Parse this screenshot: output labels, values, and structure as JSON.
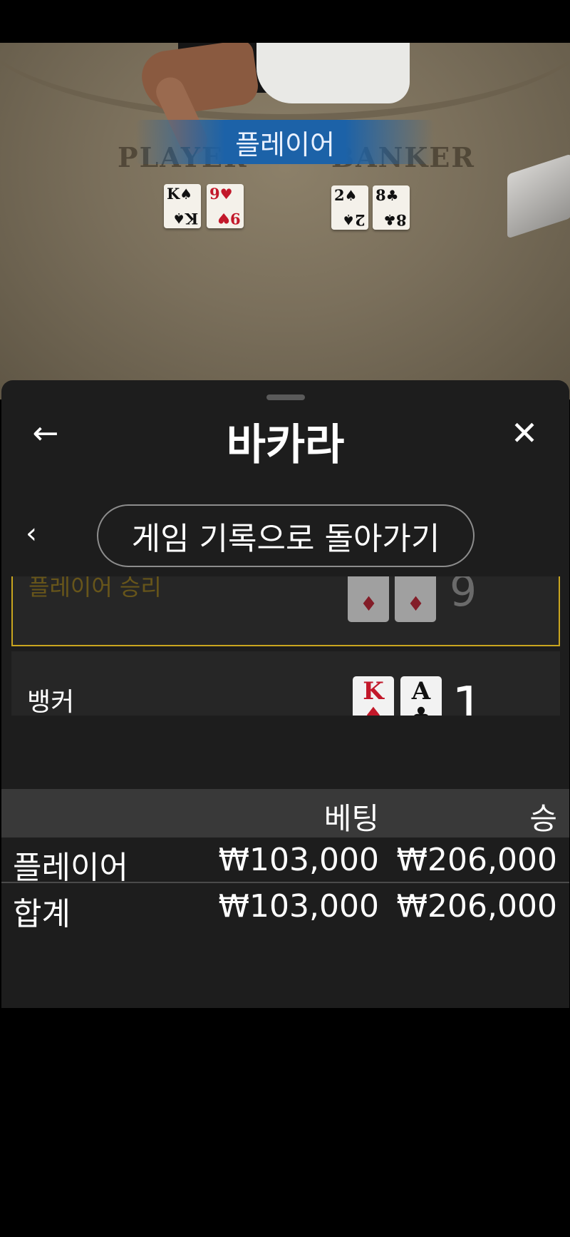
{
  "video": {
    "winner_banner": "플레이어",
    "zone_player": "PLAYER",
    "zone_banker": "BANKER",
    "player_cards": [
      {
        "rank": "K",
        "suit": "♠",
        "color": "black"
      },
      {
        "rank": "9",
        "suit": "♥",
        "color": "red"
      }
    ],
    "banker_cards": [
      {
        "rank": "2",
        "suit": "♠",
        "color": "black"
      },
      {
        "rank": "8",
        "suit": "♣",
        "color": "black"
      }
    ]
  },
  "header": {
    "title": "바카라",
    "back_icon": "←",
    "close_icon": "✕"
  },
  "nav": {
    "prev_icon": "‹",
    "history_button": "게임 기록으로 돌아가기"
  },
  "rounds": {
    "player_row": {
      "label": "플레이어 승리",
      "total": "9",
      "cards": [
        {
          "suit": "♦"
        },
        {
          "suit": "♦"
        }
      ]
    },
    "banker_row": {
      "label": "뱅커",
      "total": "1",
      "cards": [
        {
          "rank": "K",
          "suit": "♦",
          "color": "red"
        },
        {
          "rank": "A",
          "suit": "♣",
          "color": "black"
        }
      ]
    }
  },
  "bets": {
    "headers": {
      "bet": "베팅",
      "win": "승"
    },
    "rows": [
      {
        "name": "플레이어",
        "bet": "₩103,000",
        "win": "₩206,000"
      },
      {
        "name": "합계",
        "bet": "₩103,000",
        "win": "₩206,000"
      }
    ]
  },
  "colors": {
    "panel_bg": "#1d1d1d",
    "highlight_border": "#c9a51f",
    "banner_blue": "#1c62a8"
  }
}
